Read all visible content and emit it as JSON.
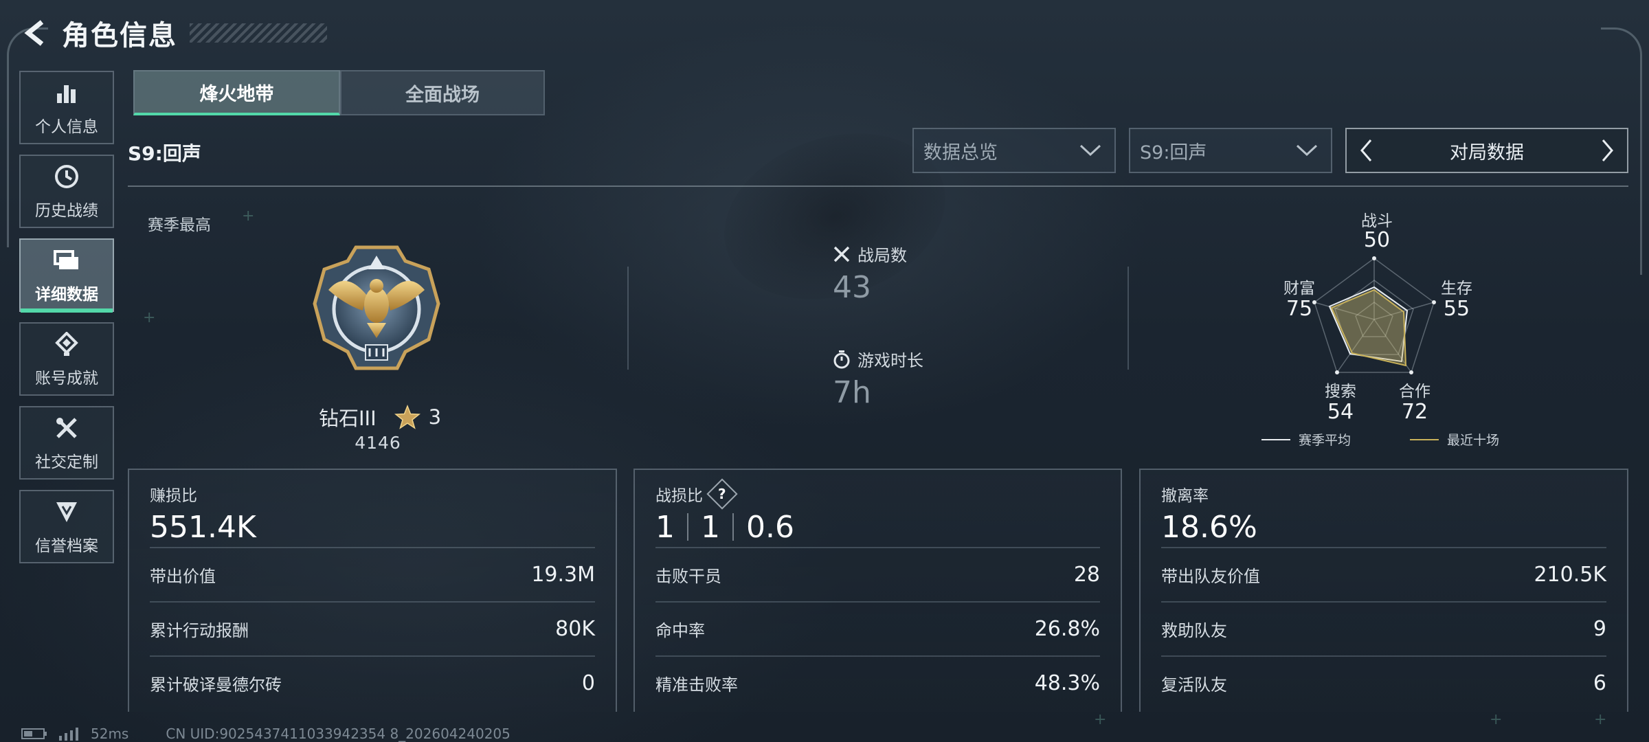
{
  "header": {
    "title": "角色信息"
  },
  "sidebar": {
    "items": [
      {
        "label": "个人信息",
        "icon": "bar-chart-icon"
      },
      {
        "label": "历史战绩",
        "icon": "history-icon"
      },
      {
        "label": "详细数据",
        "icon": "folder-icon",
        "active": true
      },
      {
        "label": "账号成就",
        "icon": "achievement-icon"
      },
      {
        "label": "社交定制",
        "icon": "tools-icon"
      },
      {
        "label": "信誉档案",
        "icon": "credit-icon"
      }
    ]
  },
  "mode_tabs": {
    "active": "烽火地带",
    "inactive": "全面战场"
  },
  "season_label": "S9:回声",
  "filters": {
    "data_overview": "数据总览",
    "season": "S9:回声",
    "pager_label": "对局数据"
  },
  "rank": {
    "caption": "赛季最高",
    "tier": "钻石III",
    "stars": "3",
    "points": "4146"
  },
  "middle_stats": {
    "matches_label": "战局数",
    "matches_value": "43",
    "playtime_label": "游戏时长",
    "playtime_value": "7h"
  },
  "radar": {
    "axes": [
      {
        "label": "战斗",
        "value": "50"
      },
      {
        "label": "生存",
        "value": "55"
      },
      {
        "label": "合作",
        "value": "72"
      },
      {
        "label": "搜索",
        "value": "54"
      },
      {
        "label": "财富",
        "value": "75"
      }
    ],
    "legend_season_avg": "赛季平均",
    "legend_recent": "最近十场",
    "season_avg_color": "#e8ecef",
    "recent_color": "#c9b25a"
  },
  "cards": {
    "profit": {
      "title": "赚损比",
      "main": "551.4K",
      "rows": [
        {
          "label": "带出价值",
          "value": "19.3M"
        },
        {
          "label": "累计行动报酬",
          "value": "80K"
        },
        {
          "label": "累计破译曼德尔砖",
          "value": "0"
        }
      ]
    },
    "kd": {
      "title": "战损比",
      "help": "?",
      "k": "1",
      "d": "1",
      "ratio": "0.6",
      "rows": [
        {
          "label": "击败干员",
          "value": "28"
        },
        {
          "label": "命中率",
          "value": "26.8%"
        },
        {
          "label": "精准击败率",
          "value": "48.3%"
        }
      ]
    },
    "extract": {
      "title": "撤离率",
      "main": "18.6%",
      "rows": [
        {
          "label": "带出队友价值",
          "value": "210.5K"
        },
        {
          "label": "救助队友",
          "value": "9"
        },
        {
          "label": "复活队友",
          "value": "6"
        }
      ]
    }
  },
  "footer": {
    "ping": "52ms",
    "uid": "CN UID:9025437411033942354 8_202604240205"
  }
}
